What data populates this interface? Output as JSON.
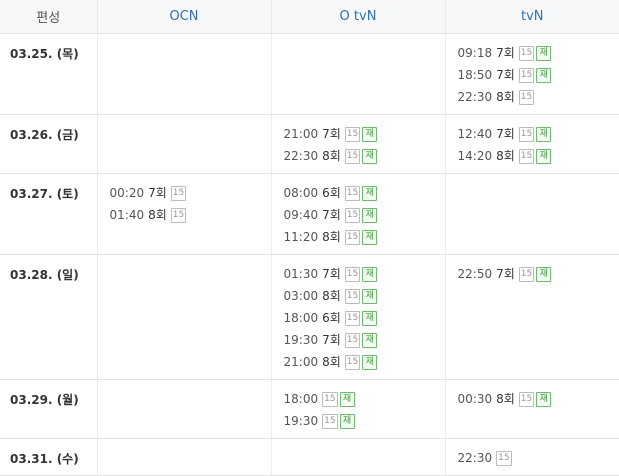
{
  "header": {
    "label": "편성",
    "channels": [
      "OCN",
      "O tvN",
      "tvN"
    ]
  },
  "badges": {
    "age": "15",
    "rerun": "재"
  },
  "colors": {
    "header_link": "#2e6fb5",
    "rerun": "#3d9a3d",
    "age": "#999999"
  },
  "rows": [
    {
      "date": "03.25. (목)",
      "height": 80,
      "cells": [
        [],
        [],
        [
          {
            "time": "09:18",
            "ep": "7회",
            "age": true,
            "rerun": true
          },
          {
            "time": "18:50",
            "ep": "7회",
            "age": true,
            "rerun": true
          },
          {
            "time": "22:30",
            "ep": "8회",
            "age": true,
            "rerun": false
          }
        ]
      ]
    },
    {
      "date": "03.26. (금)",
      "height": 58,
      "cells": [
        [],
        [
          {
            "time": "21:00",
            "ep": "7회",
            "age": true,
            "rerun": true
          },
          {
            "time": "22:30",
            "ep": "8회",
            "age": true,
            "rerun": true
          }
        ],
        [
          {
            "time": "12:40",
            "ep": "7회",
            "age": true,
            "rerun": true
          },
          {
            "time": "14:20",
            "ep": "8회",
            "age": true,
            "rerun": true
          }
        ]
      ]
    },
    {
      "date": "03.27. (토)",
      "height": 80,
      "cells": [
        [
          {
            "time": "00:20",
            "ep": "7회",
            "age": true,
            "rerun": false
          },
          {
            "time": "01:40",
            "ep": "8회",
            "age": true,
            "rerun": false
          }
        ],
        [
          {
            "time": "08:00",
            "ep": "6회",
            "age": true,
            "rerun": true
          },
          {
            "time": "09:40",
            "ep": "7회",
            "age": true,
            "rerun": true
          },
          {
            "time": "11:20",
            "ep": "8회",
            "age": true,
            "rerun": true
          }
        ],
        []
      ]
    },
    {
      "date": "03.28. (일)",
      "height": 124,
      "cells": [
        [],
        [
          {
            "time": "01:30",
            "ep": "7회",
            "age": true,
            "rerun": true
          },
          {
            "time": "03:00",
            "ep": "8회",
            "age": true,
            "rerun": true
          },
          {
            "time": "18:00",
            "ep": "6회",
            "age": true,
            "rerun": true
          },
          {
            "time": "19:30",
            "ep": "7회",
            "age": true,
            "rerun": true
          },
          {
            "time": "21:00",
            "ep": "8회",
            "age": true,
            "rerun": true
          }
        ],
        [
          {
            "time": "22:50",
            "ep": "7회",
            "age": true,
            "rerun": true
          }
        ]
      ]
    },
    {
      "date": "03.29. (월)",
      "height": 58,
      "cells": [
        [],
        [
          {
            "time": "18:00",
            "ep": "",
            "age": true,
            "rerun": true
          },
          {
            "time": "19:30",
            "ep": "",
            "age": true,
            "rerun": true
          }
        ],
        [
          {
            "time": "00:30",
            "ep": "8회",
            "age": true,
            "rerun": true
          }
        ]
      ]
    },
    {
      "date": "03.31. (수)",
      "height": 36,
      "cells": [
        [],
        [],
        [
          {
            "time": "22:30",
            "ep": "",
            "age": true,
            "rerun": false
          }
        ]
      ]
    }
  ]
}
